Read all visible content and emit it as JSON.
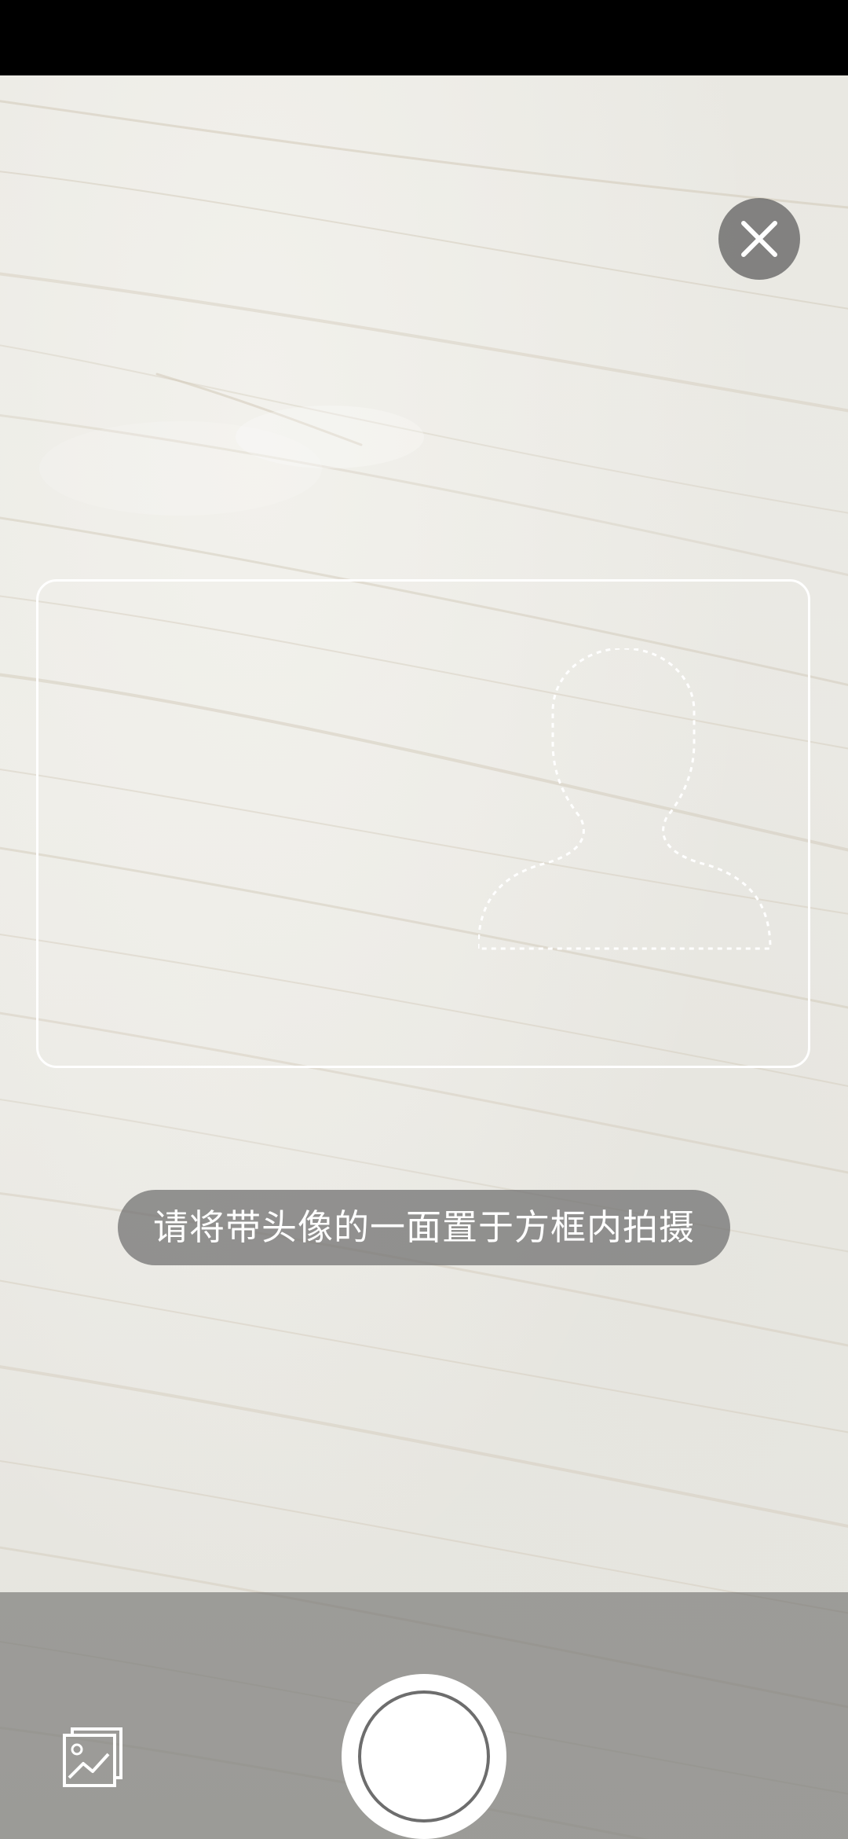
{
  "camera": {
    "hint_text": "请将带头像的一面置于方框内拍摄"
  },
  "controls": {
    "close_icon": "close-icon",
    "gallery_icon": "gallery-icon",
    "shutter_icon": "shutter-icon"
  },
  "colors": {
    "status_bar": "#000000",
    "frame_border": "#ffffff",
    "hint_background": "rgba(110,110,110,0.72)",
    "bottom_bar": "rgba(110,110,108,0.62)",
    "shutter": "#ffffff"
  }
}
